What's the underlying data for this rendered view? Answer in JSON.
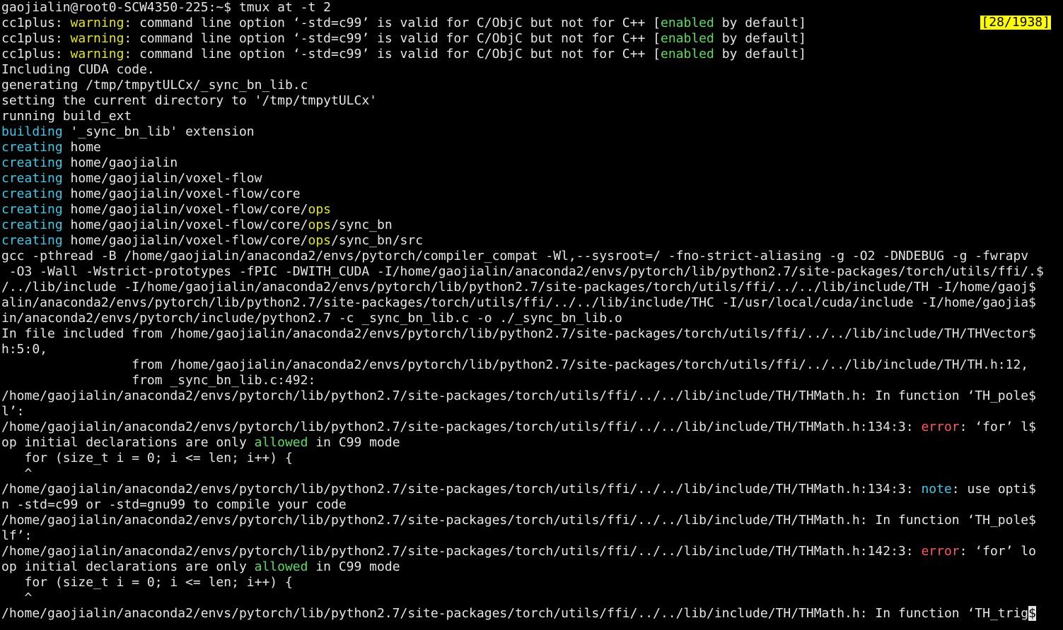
{
  "window": {
    "type": "terminal",
    "pager_position": "[28/1938]"
  },
  "colors": {
    "background": "#000000",
    "text": "#e6e6e6",
    "warning": "#e6e61e",
    "enabled": "#5fdd5f",
    "building_creating": "#3ec8e6",
    "ops": "#e6e61e",
    "error": "#ff5a5a",
    "note": "#3ec8e6",
    "allowed": "#5fdd5f",
    "pager_badge_bg": "#ffff00"
  },
  "lines": [
    [
      {
        "t": "gaojialin@root0-SCW4350-225:~$ tmux at -t 2",
        "c": "plain"
      }
    ],
    [
      {
        "t": "cc1plus: ",
        "c": "plain"
      },
      {
        "t": "warning",
        "c": "warning"
      },
      {
        "t": ": command line option ‘-std=c99’ is valid for C/ObjC but not for C++ [",
        "c": "plain"
      },
      {
        "t": "enabled",
        "c": "enabled"
      },
      {
        "t": " by default]",
        "c": "plain"
      }
    ],
    [
      {
        "t": "cc1plus: ",
        "c": "plain"
      },
      {
        "t": "warning",
        "c": "warning"
      },
      {
        "t": ": command line option ‘-std=c99’ is valid for C/ObjC but not for C++ [",
        "c": "plain"
      },
      {
        "t": "enabled",
        "c": "enabled"
      },
      {
        "t": " by default]",
        "c": "plain"
      }
    ],
    [
      {
        "t": "cc1plus: ",
        "c": "plain"
      },
      {
        "t": "warning",
        "c": "warning"
      },
      {
        "t": ": command line option ‘-std=c99’ is valid for C/ObjC but not for C++ [",
        "c": "plain"
      },
      {
        "t": "enabled",
        "c": "enabled"
      },
      {
        "t": " by default]",
        "c": "plain"
      }
    ],
    [
      {
        "t": "Including CUDA code.",
        "c": "plain"
      }
    ],
    [
      {
        "t": "generating /tmp/tmpytULCx/_sync_bn_lib.c",
        "c": "plain"
      }
    ],
    [
      {
        "t": "setting the current directory to '/tmp/tmpytULCx'",
        "c": "plain"
      }
    ],
    [
      {
        "t": "running build_ext",
        "c": "plain"
      }
    ],
    [
      {
        "t": "building",
        "c": "building"
      },
      {
        "t": " '_sync_bn_lib' extension",
        "c": "plain"
      }
    ],
    [
      {
        "t": "creating",
        "c": "building"
      },
      {
        "t": " home",
        "c": "plain"
      }
    ],
    [
      {
        "t": "creating",
        "c": "building"
      },
      {
        "t": " home/gaojialin",
        "c": "plain"
      }
    ],
    [
      {
        "t": "creating",
        "c": "building"
      },
      {
        "t": " home/gaojialin/voxel-flow",
        "c": "plain"
      }
    ],
    [
      {
        "t": "creating",
        "c": "building"
      },
      {
        "t": " home/gaojialin/voxel-flow/core",
        "c": "plain"
      }
    ],
    [
      {
        "t": "creating",
        "c": "building"
      },
      {
        "t": " home/gaojialin/voxel-flow/core/",
        "c": "plain"
      },
      {
        "t": "ops",
        "c": "ops"
      }
    ],
    [
      {
        "t": "creating",
        "c": "building"
      },
      {
        "t": " home/gaojialin/voxel-flow/core/",
        "c": "plain"
      },
      {
        "t": "ops",
        "c": "ops"
      },
      {
        "t": "/sync_bn",
        "c": "plain"
      }
    ],
    [
      {
        "t": "creating",
        "c": "building"
      },
      {
        "t": " home/gaojialin/voxel-flow/core/",
        "c": "plain"
      },
      {
        "t": "ops",
        "c": "ops"
      },
      {
        "t": "/sync_bn/src",
        "c": "plain"
      }
    ],
    [
      {
        "t": "gcc -pthread -B /home/gaojialin/anaconda2/envs/pytorch/compiler_compat -Wl,--sysroot=/ -fno-strict-aliasing -g -O2 -DNDEBUG -g -fwrapv",
        "c": "plain"
      }
    ],
    [
      {
        "t": " -O3 -Wall -Wstrict-prototypes -fPIC -DWITH_CUDA -I/home/gaojialin/anaconda2/envs/pytorch/lib/python2.7/site-packages/torch/utils/ffi/.$",
        "c": "plain"
      }
    ],
    [
      {
        "t": "/../lib/include -I/home/gaojialin/anaconda2/envs/pytorch/lib/python2.7/site-packages/torch/utils/ffi/../../lib/include/TH -I/home/gaoj$",
        "c": "plain"
      }
    ],
    [
      {
        "t": "alin/anaconda2/envs/pytorch/lib/python2.7/site-packages/torch/utils/ffi/../../lib/include/THC -I/usr/local/cuda/include -I/home/gaojia$",
        "c": "plain"
      }
    ],
    [
      {
        "t": "in/anaconda2/envs/pytorch/include/python2.7 -c _sync_bn_lib.c -o ./_sync_bn_lib.o",
        "c": "plain"
      }
    ],
    [
      {
        "t": "In file included from /home/gaojialin/anaconda2/envs/pytorch/lib/python2.7/site-packages/torch/utils/ffi/../../lib/include/TH/THVector$",
        "c": "plain"
      }
    ],
    [
      {
        "t": "h:5:0,",
        "c": "plain"
      }
    ],
    [
      {
        "t": "                 from /home/gaojialin/anaconda2/envs/pytorch/lib/python2.7/site-packages/torch/utils/ffi/../../lib/include/TH/TH.h:12,",
        "c": "plain"
      }
    ],
    [
      {
        "t": "                 from _sync_bn_lib.c:492:",
        "c": "plain"
      }
    ],
    [
      {
        "t": "/home/gaojialin/anaconda2/envs/pytorch/lib/python2.7/site-packages/torch/utils/ffi/../../lib/include/TH/THMath.h: In function ‘TH_pole$",
        "c": "plain"
      }
    ],
    [
      {
        "t": "l’:",
        "c": "plain"
      }
    ],
    [
      {
        "t": "/home/gaojialin/anaconda2/envs/pytorch/lib/python2.7/site-packages/torch/utils/ffi/../../lib/include/TH/THMath.h:134:3: ",
        "c": "plain"
      },
      {
        "t": "error",
        "c": "error"
      },
      {
        "t": ": ‘for’ l$",
        "c": "plain"
      }
    ],
    [
      {
        "t": "op initial declarations are only ",
        "c": "plain"
      },
      {
        "t": "allowed",
        "c": "allowed"
      },
      {
        "t": " in C99 mode",
        "c": "plain"
      }
    ],
    [
      {
        "t": "   for (size_t i = 0; i <= len; i++) {",
        "c": "plain"
      }
    ],
    [
      {
        "t": "   ^",
        "c": "plain"
      }
    ],
    [
      {
        "t": "/home/gaojialin/anaconda2/envs/pytorch/lib/python2.7/site-packages/torch/utils/ffi/../../lib/include/TH/THMath.h:134:3: ",
        "c": "plain"
      },
      {
        "t": "note",
        "c": "note"
      },
      {
        "t": ": use opti$",
        "c": "plain"
      }
    ],
    [
      {
        "t": "n -std=c99 or -std=gnu99 to compile your code",
        "c": "plain"
      }
    ],
    [
      {
        "t": "/home/gaojialin/anaconda2/envs/pytorch/lib/python2.7/site-packages/torch/utils/ffi/../../lib/include/TH/THMath.h: In function ‘TH_pole$",
        "c": "plain"
      }
    ],
    [
      {
        "t": "lf’:",
        "c": "plain"
      }
    ],
    [
      {
        "t": "/home/gaojialin/anaconda2/envs/pytorch/lib/python2.7/site-packages/torch/utils/ffi/../../lib/include/TH/THMath.h:142:3: ",
        "c": "plain"
      },
      {
        "t": "error",
        "c": "error"
      },
      {
        "t": ": ‘for’ lo",
        "c": "plain"
      }
    ],
    [
      {
        "t": "op initial declarations are only ",
        "c": "plain"
      },
      {
        "t": "allowed",
        "c": "allowed"
      },
      {
        "t": " in C99 mode",
        "c": "plain"
      }
    ],
    [
      {
        "t": "   for (size_t i = 0; i <= len; i++) {",
        "c": "plain"
      }
    ],
    [
      {
        "t": "   ^",
        "c": "plain"
      }
    ],
    [
      {
        "t": "/home/gaojialin/anaconda2/envs/pytorch/lib/python2.7/site-packages/torch/utils/ffi/../../lib/include/TH/THMath.h: In function ‘TH_trig",
        "c": "plain"
      },
      {
        "t": "$",
        "c": "cursor"
      }
    ]
  ]
}
